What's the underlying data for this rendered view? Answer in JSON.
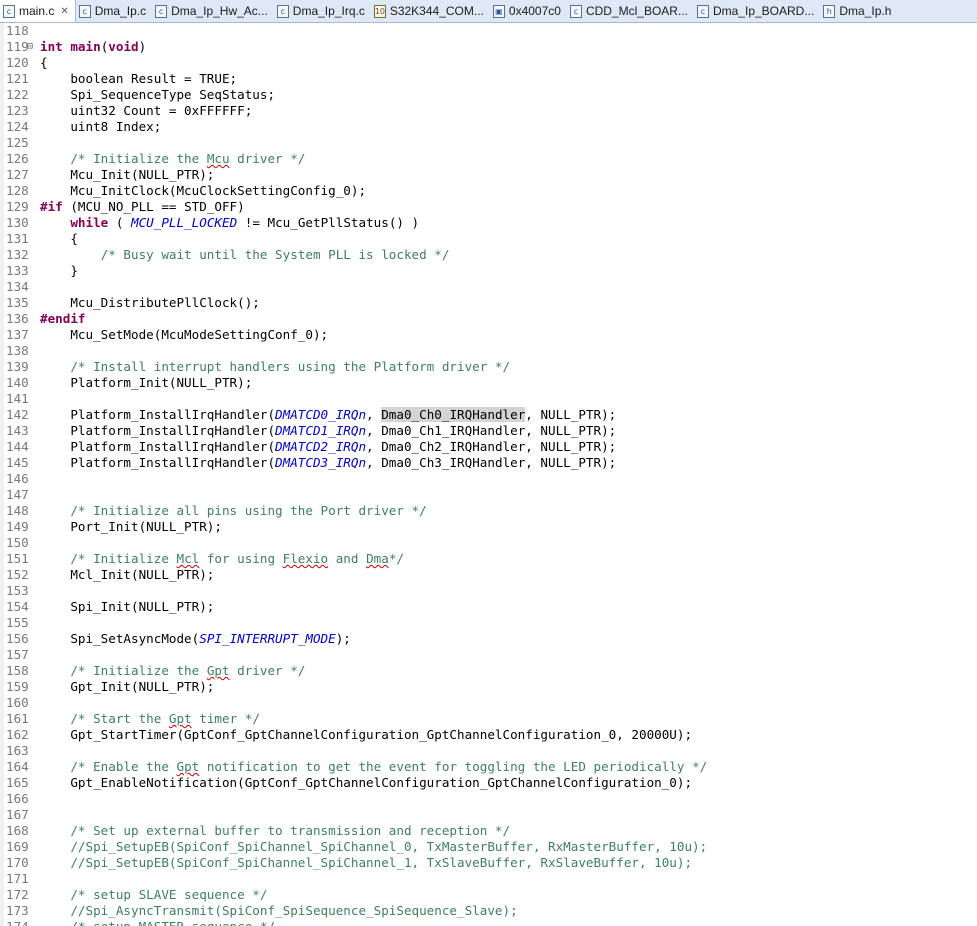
{
  "tabs": [
    {
      "label": "main.c",
      "icon": "c-file-icon",
      "active": true
    },
    {
      "label": "Dma_Ip.c",
      "icon": "c-file-icon"
    },
    {
      "label": "Dma_Ip_Hw_Ac...",
      "icon": "c-file-icon"
    },
    {
      "label": "Dma_Ip_Irq.c",
      "icon": "c-file-icon"
    },
    {
      "label": "S32K344_COM...",
      "icon": "binary-file-icon"
    },
    {
      "label": "0x4007c0",
      "icon": "memory-icon"
    },
    {
      "label": "CDD_Mcl_BOAR...",
      "icon": "c-file-icon"
    },
    {
      "label": "Dma_Ip_BOARD...",
      "icon": "c-file-icon"
    },
    {
      "label": "Dma_Ip.h",
      "icon": "h-file-icon"
    }
  ],
  "lines": [
    {
      "n": "118",
      "parts": []
    },
    {
      "n": "119",
      "fold": true,
      "parts": [
        [
          "k",
          "int"
        ],
        [
          "t",
          " "
        ],
        [
          "b",
          "main"
        ],
        [
          "t",
          "("
        ],
        [
          "k",
          "void"
        ],
        [
          "t",
          ")"
        ]
      ]
    },
    {
      "n": "120",
      "parts": [
        [
          "t",
          "{"
        ]
      ]
    },
    {
      "n": "121",
      "parts": [
        [
          "t",
          "    boolean Result = TRUE;"
        ]
      ]
    },
    {
      "n": "122",
      "parts": [
        [
          "t",
          "    Spi_SequenceType SeqStatus;"
        ]
      ]
    },
    {
      "n": "123",
      "parts": [
        [
          "t",
          "    uint32 Count = 0xFFFFFF;"
        ]
      ]
    },
    {
      "n": "124",
      "parts": [
        [
          "t",
          "    uint8 Index;"
        ]
      ]
    },
    {
      "n": "125",
      "parts": []
    },
    {
      "n": "126",
      "parts": [
        [
          "c",
          "    /* Initialize the "
        ],
        [
          "cs",
          "Mcu"
        ],
        [
          "c",
          " driver */"
        ]
      ]
    },
    {
      "n": "127",
      "parts": [
        [
          "t",
          "    Mcu_Init(NULL_PTR);"
        ]
      ]
    },
    {
      "n": "128",
      "parts": [
        [
          "t",
          "    Mcu_InitClock(McuClockSettingConfig_0);"
        ]
      ]
    },
    {
      "n": "129",
      "parts": [
        [
          "k",
          "#if"
        ],
        [
          "t",
          " (MCU_NO_PLL == STD_OFF)"
        ]
      ]
    },
    {
      "n": "130",
      "parts": [
        [
          "t",
          "    "
        ],
        [
          "k",
          "while"
        ],
        [
          "t",
          " ( "
        ],
        [
          "m",
          "MCU_PLL_LOCKED"
        ],
        [
          "t",
          " != Mcu_GetPllStatus() )"
        ]
      ]
    },
    {
      "n": "131",
      "parts": [
        [
          "t",
          "    {"
        ]
      ]
    },
    {
      "n": "132",
      "parts": [
        [
          "c",
          "        /* Busy wait until the System PLL is locked */"
        ]
      ]
    },
    {
      "n": "133",
      "parts": [
        [
          "t",
          "    }"
        ]
      ]
    },
    {
      "n": "134",
      "parts": []
    },
    {
      "n": "135",
      "parts": [
        [
          "t",
          "    Mcu_DistributePllClock();"
        ]
      ]
    },
    {
      "n": "136",
      "parts": [
        [
          "k",
          "#endif"
        ]
      ]
    },
    {
      "n": "137",
      "parts": [
        [
          "t",
          "    Mcu_SetMode(McuModeSettingConf_0);"
        ]
      ]
    },
    {
      "n": "138",
      "parts": []
    },
    {
      "n": "139",
      "parts": [
        [
          "c",
          "    /* Install interrupt handlers using the Platform driver */"
        ]
      ]
    },
    {
      "n": "140",
      "parts": [
        [
          "t",
          "    Platform_Init(NULL_PTR);"
        ]
      ]
    },
    {
      "n": "141",
      "parts": []
    },
    {
      "n": "142",
      "parts": [
        [
          "t",
          "    Platform_InstallIrqHandler("
        ],
        [
          "m",
          "DMATCD0_IRQn"
        ],
        [
          "t",
          ", "
        ],
        [
          "h",
          "Dma0_Ch0_IRQHandler"
        ],
        [
          "t",
          ", NULL_PTR);"
        ]
      ]
    },
    {
      "n": "143",
      "parts": [
        [
          "t",
          "    Platform_InstallIrqHandler("
        ],
        [
          "m",
          "DMATCD1_IRQn"
        ],
        [
          "t",
          ", Dma0_Ch1_IRQHandler, NULL_PTR);"
        ]
      ]
    },
    {
      "n": "144",
      "parts": [
        [
          "t",
          "    Platform_InstallIrqHandler("
        ],
        [
          "m",
          "DMATCD2_IRQn"
        ],
        [
          "t",
          ", Dma0_Ch2_IRQHandler, NULL_PTR);"
        ]
      ]
    },
    {
      "n": "145",
      "parts": [
        [
          "t",
          "    Platform_InstallIrqHandler("
        ],
        [
          "m",
          "DMATCD3_IRQn"
        ],
        [
          "t",
          ", Dma0_Ch3_IRQHandler, NULL_PTR);"
        ]
      ]
    },
    {
      "n": "146",
      "parts": []
    },
    {
      "n": "147",
      "parts": []
    },
    {
      "n": "148",
      "parts": [
        [
          "c",
          "    /* Initialize all pins using the Port driver */"
        ]
      ]
    },
    {
      "n": "149",
      "parts": [
        [
          "t",
          "    Port_Init(NULL_PTR);"
        ]
      ]
    },
    {
      "n": "150",
      "parts": []
    },
    {
      "n": "151",
      "parts": [
        [
          "c",
          "    /* Initialize "
        ],
        [
          "cs",
          "Mcl"
        ],
        [
          "c",
          " for using "
        ],
        [
          "cs",
          "Flexio"
        ],
        [
          "c",
          " and "
        ],
        [
          "cs",
          "Dma"
        ],
        [
          "c",
          "*/"
        ]
      ]
    },
    {
      "n": "152",
      "parts": [
        [
          "t",
          "    Mcl_Init(NULL_PTR);"
        ]
      ]
    },
    {
      "n": "153",
      "parts": []
    },
    {
      "n": "154",
      "parts": [
        [
          "t",
          "    Spi_Init(NULL_PTR);"
        ]
      ]
    },
    {
      "n": "155",
      "parts": []
    },
    {
      "n": "156",
      "parts": [
        [
          "t",
          "    Spi_SetAsyncMode("
        ],
        [
          "m",
          "SPI_INTERRUPT_MODE"
        ],
        [
          "t",
          ");"
        ]
      ]
    },
    {
      "n": "157",
      "parts": []
    },
    {
      "n": "158",
      "parts": [
        [
          "c",
          "    /* Initialize the "
        ],
        [
          "cs",
          "Gpt"
        ],
        [
          "c",
          " driver */"
        ]
      ]
    },
    {
      "n": "159",
      "parts": [
        [
          "t",
          "    Gpt_Init(NULL_PTR);"
        ]
      ]
    },
    {
      "n": "160",
      "parts": []
    },
    {
      "n": "161",
      "parts": [
        [
          "c",
          "    /* Start the "
        ],
        [
          "cs",
          "Gpt"
        ],
        [
          "c",
          " timer */"
        ]
      ]
    },
    {
      "n": "162",
      "parts": [
        [
          "t",
          "    Gpt_StartTimer(GptConf_GptChannelConfiguration_GptChannelConfiguration_0, 20000U);"
        ]
      ]
    },
    {
      "n": "163",
      "parts": []
    },
    {
      "n": "164",
      "parts": [
        [
          "c",
          "    /* Enable the "
        ],
        [
          "cs",
          "Gpt"
        ],
        [
          "c",
          " notification to get the event for toggling the LED periodically */"
        ]
      ]
    },
    {
      "n": "165",
      "parts": [
        [
          "t",
          "    Gpt_EnableNotification(GptConf_GptChannelConfiguration_GptChannelConfiguration_0);"
        ]
      ]
    },
    {
      "n": "166",
      "parts": []
    },
    {
      "n": "167",
      "parts": []
    },
    {
      "n": "168",
      "parts": [
        [
          "c",
          "    /* Set up external buffer to transmission and reception */"
        ]
      ]
    },
    {
      "n": "169",
      "parts": [
        [
          "c",
          "    //Spi_SetupEB(SpiConf_SpiChannel_SpiChannel_0, TxMasterBuffer, RxMasterBuffer, 10u);"
        ]
      ]
    },
    {
      "n": "170",
      "parts": [
        [
          "c",
          "    //Spi_SetupEB(SpiConf_SpiChannel_SpiChannel_1, TxSlaveBuffer, RxSlaveBuffer, 10u);"
        ]
      ]
    },
    {
      "n": "171",
      "parts": []
    },
    {
      "n": "172",
      "parts": [
        [
          "c",
          "    /* setup SLAVE sequence */"
        ]
      ]
    },
    {
      "n": "173",
      "parts": [
        [
          "c",
          "    //Spi_AsyncTransmit(SpiConf_SpiSequence_SpiSequence_Slave);"
        ]
      ]
    },
    {
      "n": "174",
      "parts": [
        [
          "c",
          "    /* setup MASTER sequence */"
        ]
      ]
    }
  ]
}
